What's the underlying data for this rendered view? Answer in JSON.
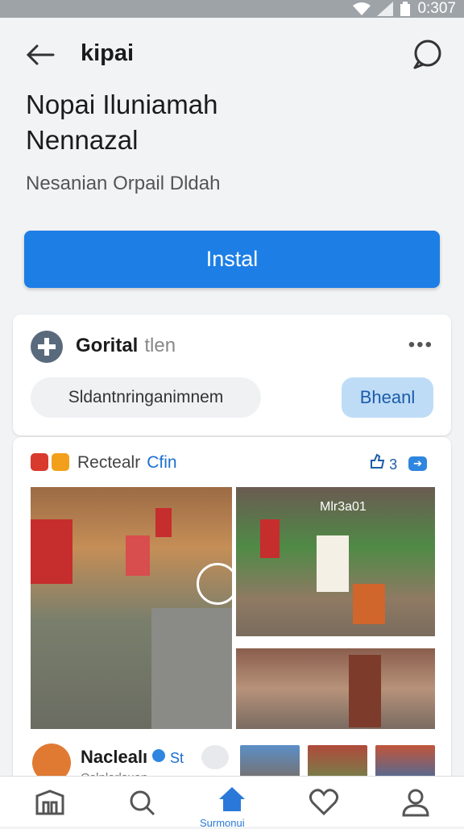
{
  "status_bar": {
    "time": "0:307"
  },
  "app_bar": {
    "title": "kipai"
  },
  "headline": "Nopai Iluniamah Nennazal",
  "subtitle": "Nesanian Orpail Dldah",
  "install_button": {
    "label": "Instal"
  },
  "card_app": {
    "name": "Gorital",
    "name_suffix": "tlen",
    "search_pill": "Sldantnringanimnem",
    "action_button": "Bheanl"
  },
  "card_post": {
    "label": "Rectealr",
    "label_link": "Cfin",
    "likes": "3",
    "photo_caption": "Mlr3a01",
    "bottom": {
      "name": "Naclealı",
      "link": "St",
      "sub": "Oslnlarlsuan"
    }
  },
  "nav": {
    "active_label": "Surmonui"
  },
  "colors": {
    "primary": "#1d7fe6",
    "secondary_button_bg": "#bfdcf7",
    "status_bar": "#9ea3a8"
  }
}
